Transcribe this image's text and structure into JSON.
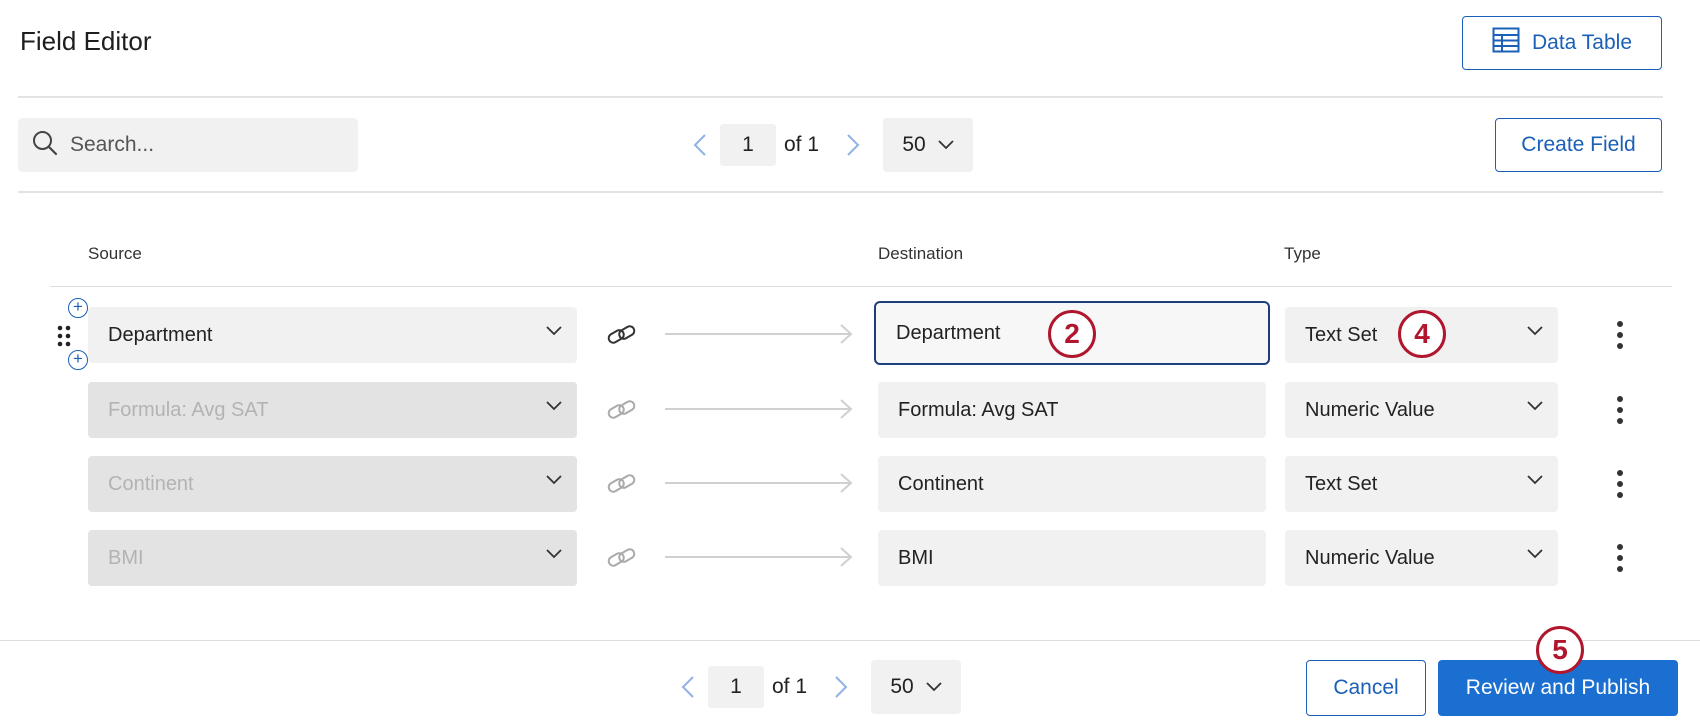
{
  "header": {
    "title": "Field Editor",
    "data_table_label": "Data Table"
  },
  "toolbar": {
    "search_placeholder": "Search...",
    "page_current": "1",
    "page_of": "of 1",
    "per_page": "50",
    "create_field_label": "Create Field"
  },
  "columns": {
    "source": "Source",
    "destination": "Destination",
    "type": "Type"
  },
  "rows": [
    {
      "source": "Department",
      "source_disabled": false,
      "destination": "Department",
      "type": "Text Set"
    },
    {
      "source": "Formula: Avg SAT",
      "source_disabled": true,
      "destination": "Formula: Avg SAT",
      "type": "Numeric Value"
    },
    {
      "source": "Continent",
      "source_disabled": true,
      "destination": "Continent",
      "type": "Text Set"
    },
    {
      "source": "BMI",
      "source_disabled": true,
      "destination": "BMI",
      "type": "Numeric Value"
    }
  ],
  "badges": {
    "destination": "2",
    "type": "4",
    "publish": "5"
  },
  "footer": {
    "page_current": "1",
    "page_of": "of 1",
    "per_page": "50",
    "cancel_label": "Cancel",
    "publish_label": "Review and Publish"
  },
  "colors": {
    "accent": "#1a6fd0",
    "outline": "#1a5fb8",
    "badge": "#b0162d"
  }
}
